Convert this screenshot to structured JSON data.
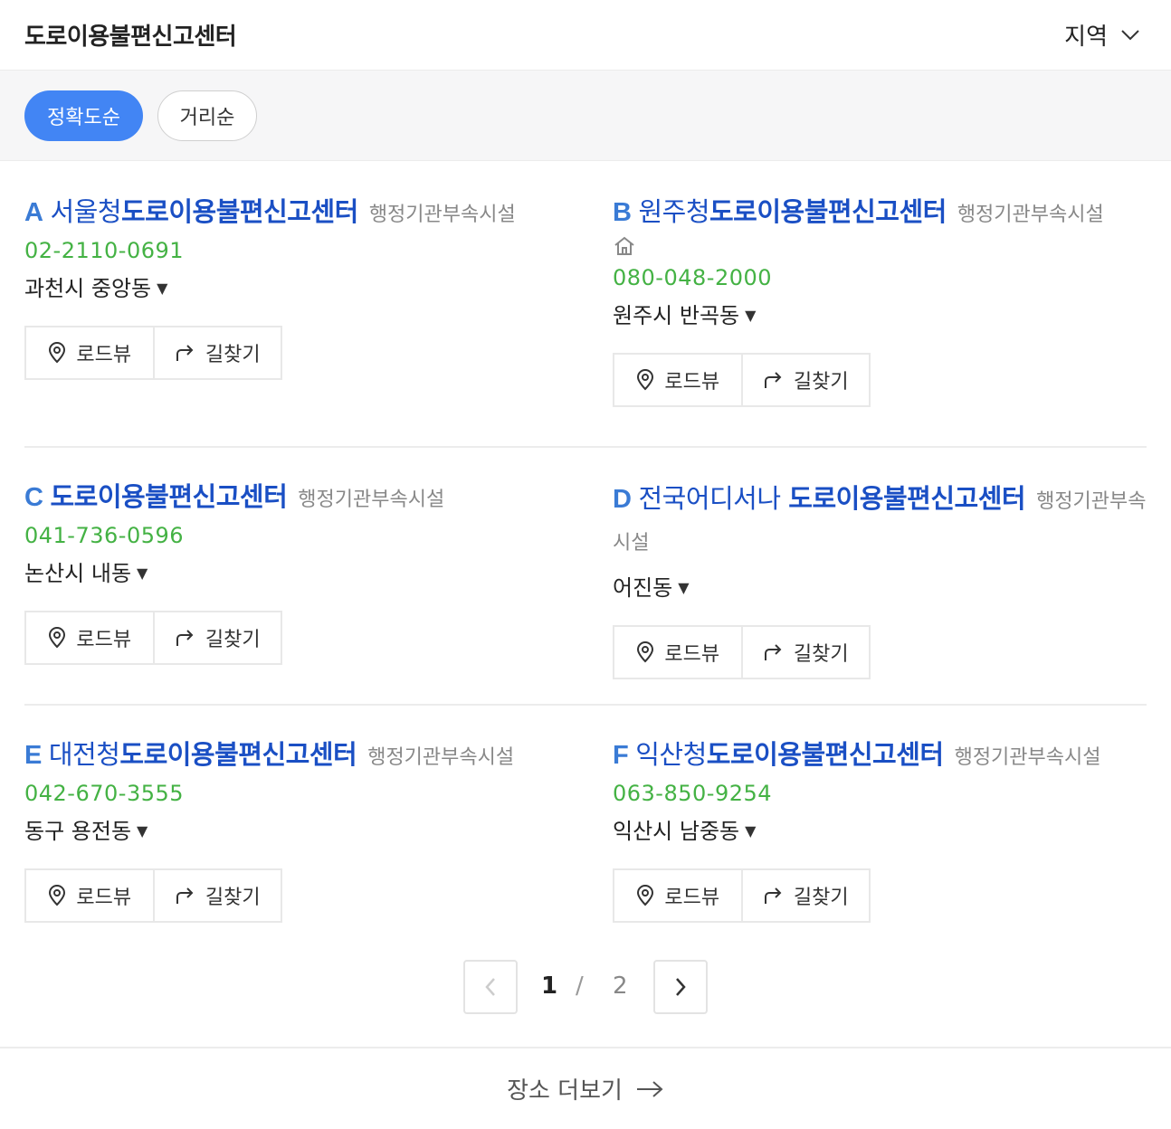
{
  "header": {
    "title": "도로이용불편신고센터",
    "region_label": "지역"
  },
  "sort": {
    "active": "정확도순",
    "other": "거리순"
  },
  "results": [
    {
      "letter": "A",
      "prefix": "서울청",
      "name": "도로이용불편신고센터",
      "category": "행정기관부속시설",
      "phone": "02-2110-0691",
      "address": "과천시 중앙동",
      "roadview": "로드뷰",
      "directions": "길찾기"
    },
    {
      "letter": "B",
      "prefix": "원주청",
      "name": "도로이용불편신고센터",
      "category": "행정기관부속시설",
      "phone": "080-048-2000",
      "address": "원주시 반곡동",
      "roadview": "로드뷰",
      "directions": "길찾기",
      "home_icon": "home-icon"
    },
    {
      "letter": "C",
      "prefix": "",
      "name": "도로이용불편신고센터",
      "category": "행정기관부속시설",
      "phone": "041-736-0596",
      "address": "논산시 내동",
      "roadview": "로드뷰",
      "directions": "길찾기"
    },
    {
      "letter": "D",
      "prefix": "전국어디서나 ",
      "name": "도로이용불편신고센터",
      "category": "행정기관부속시설",
      "phone": "",
      "address": "어진동",
      "roadview": "로드뷰",
      "directions": "길찾기"
    },
    {
      "letter": "E",
      "prefix": "대전청",
      "name": "도로이용불편신고센터",
      "category": "행정기관부속시설",
      "phone": "042-670-3555",
      "address": "동구 용전동",
      "roadview": "로드뷰",
      "directions": "길찾기"
    },
    {
      "letter": "F",
      "prefix": "익산청",
      "name": "도로이용불편신고센터",
      "category": "행정기관부속시설",
      "phone": "063-850-9254",
      "address": "익산시 남중동",
      "roadview": "로드뷰",
      "directions": "길찾기"
    }
  ],
  "pagination": {
    "current": "1",
    "separator": "/",
    "total": "2"
  },
  "footer": {
    "more_label": "장소 더보기"
  },
  "colors": {
    "accent": "#4285f4",
    "title_blue": "#1a4fc4",
    "phone_green": "#44b244"
  }
}
